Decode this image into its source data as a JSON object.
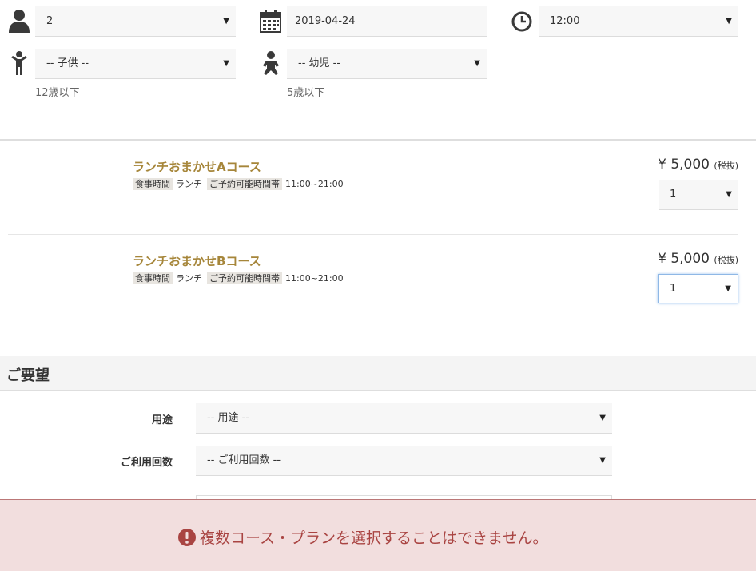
{
  "reservation": {
    "adults": {
      "icon": "person-icon",
      "value": "2"
    },
    "date": {
      "icon": "calendar-icon",
      "value": "2019-04-24"
    },
    "time": {
      "icon": "clock-icon",
      "value": "12:00"
    },
    "children": {
      "icon": "child-icon",
      "value": "-- 子供 --",
      "hint": "12歳以下"
    },
    "infants": {
      "icon": "baby-icon",
      "value": "-- 幼児 --",
      "hint": "5歳以下"
    }
  },
  "courses": [
    {
      "title": "ランチおまかせAコース",
      "meal_tag": "食事時間",
      "meal_value": "ランチ",
      "time_tag": "ご予約可能時間帯",
      "time_value": "11:00~21:00",
      "price": "¥ 5,000",
      "tax": "(税抜)",
      "qty": "1"
    },
    {
      "title": "ランチおまかせBコース",
      "meal_tag": "食事時間",
      "meal_value": "ランチ",
      "time_tag": "ご予約可能時間帯",
      "time_value": "11:00~21:00",
      "price": "¥ 5,000",
      "tax": "(税抜)",
      "qty": "1"
    }
  ],
  "requests": {
    "title": "ご要望",
    "purpose_label": "用途",
    "purpose_value": "-- 用途 --",
    "visits_label": "ご利用回数",
    "visits_value": "-- ご利用回数 --"
  },
  "alert": {
    "icon": "exclamation-circle-icon",
    "message": "複数コース・プランを選択することはできません。",
    "color": "#a94442"
  }
}
